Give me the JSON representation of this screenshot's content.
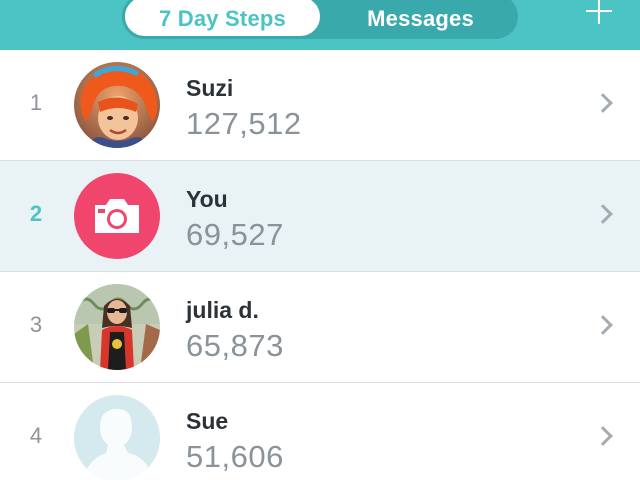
{
  "header": {
    "tabs": [
      {
        "label": "7 Day Steps",
        "active": true
      },
      {
        "label": "Messages",
        "active": false
      }
    ],
    "add_icon": "plus-icon"
  },
  "leaderboard": [
    {
      "rank": "1",
      "name": "Suzi",
      "steps": "127,512",
      "avatar": "photo-avatar-orange-hair",
      "highlight": false
    },
    {
      "rank": "2",
      "name": "You",
      "steps": "69,527",
      "avatar": "camera-icon",
      "highlight": true
    },
    {
      "rank": "3",
      "name": "julia d.",
      "steps": "65,873",
      "avatar": "photo-avatar-woman-sunglasses",
      "highlight": false
    },
    {
      "rank": "4",
      "name": "Sue",
      "steps": "51,606",
      "avatar": "default-profile-silhouette-icon",
      "highlight": false
    }
  ],
  "colors": {
    "accent": "#4cc3c4",
    "camera_avatar": "#f0466e",
    "highlight_row": "#e9f2f4",
    "default_avatar": "#d5eaee"
  }
}
